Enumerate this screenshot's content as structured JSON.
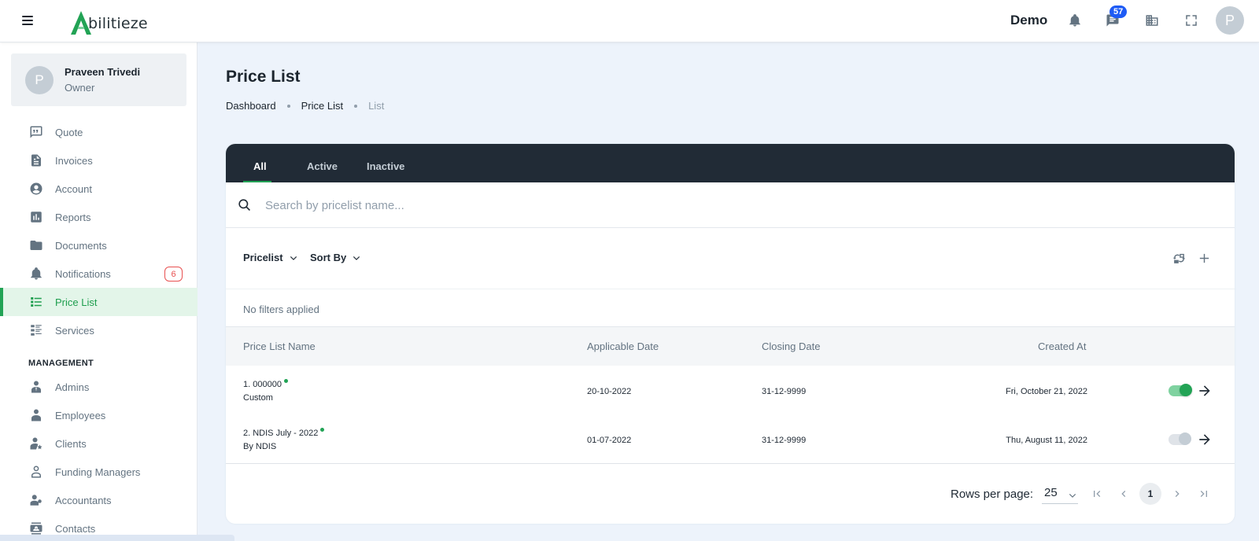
{
  "header": {
    "logo_text": "bilitieze",
    "org_name": "Demo",
    "messages_badge": "57",
    "avatar_initial": "P"
  },
  "sidebar": {
    "user": {
      "initial": "P",
      "name": "Praveen Trivedi",
      "role": "Owner"
    },
    "items": [
      {
        "label": "Quote",
        "icon": "quote-icon"
      },
      {
        "label": "Invoices",
        "icon": "invoice-icon"
      },
      {
        "label": "Account",
        "icon": "account-icon"
      },
      {
        "label": "Reports",
        "icon": "reports-icon"
      },
      {
        "label": "Documents",
        "icon": "folder-icon"
      },
      {
        "label": "Notifications",
        "icon": "bell-icon",
        "badge": "6"
      },
      {
        "label": "Price List",
        "icon": "list-icon",
        "active": true
      },
      {
        "label": "Services",
        "icon": "services-icon"
      }
    ],
    "management_title": "MANAGEMENT",
    "management_items": [
      {
        "label": "Admins",
        "icon": "admin-icon"
      },
      {
        "label": "Employees",
        "icon": "employee-icon"
      },
      {
        "label": "Clients",
        "icon": "client-icon"
      },
      {
        "label": "Funding Managers",
        "icon": "funding-manager-icon"
      },
      {
        "label": "Accountants",
        "icon": "accountant-icon"
      },
      {
        "label": "Contacts",
        "icon": "contacts-icon"
      }
    ]
  },
  "page": {
    "title": "Price List",
    "breadcrumb": [
      "Dashboard",
      "Price List",
      "List"
    ]
  },
  "tabs": [
    "All",
    "Active",
    "Inactive"
  ],
  "active_tab": "All",
  "search": {
    "placeholder": "Search by pricelist name..."
  },
  "filters": {
    "pricelist_label": "Pricelist",
    "sort_label": "Sort By",
    "status_text": "No filters applied"
  },
  "table": {
    "columns": [
      "Price List Name",
      "Applicable Date",
      "Closing Date",
      "Created At"
    ],
    "rows": [
      {
        "name": "1. 000000",
        "sub": "Custom",
        "applicable": "20-10-2022",
        "closing": "31-12-9999",
        "created": "Fri, October 21, 2022",
        "enabled": true
      },
      {
        "name": "2. NDIS July - 2022",
        "sub": "By NDIS",
        "applicable": "01-07-2022",
        "closing": "31-12-9999",
        "created": "Thu, August 11, 2022",
        "enabled": false
      }
    ]
  },
  "pagination": {
    "rows_label": "Rows per page:",
    "rows_value": "25",
    "current_page": "1"
  },
  "colors": {
    "accent": "#22a355",
    "tab_bar": "#212b36",
    "badge_blue": "#1e5bf5",
    "badge_red": "#e85050"
  }
}
